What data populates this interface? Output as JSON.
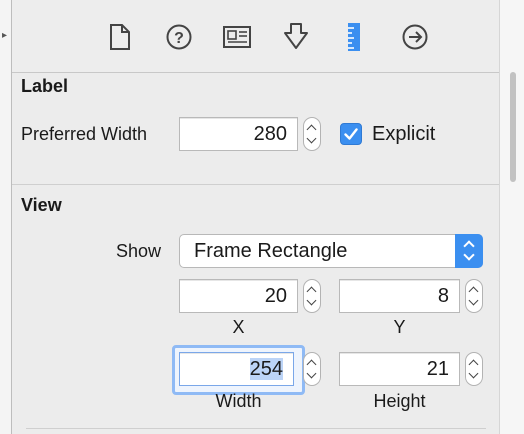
{
  "toolbar": {
    "icons": [
      "file-icon",
      "help-icon",
      "identity-icon",
      "attributes-icon",
      "ruler-icon",
      "connections-icon"
    ],
    "active": "ruler-icon",
    "active_color": "#3b8ff0"
  },
  "label_section": {
    "title": "Label",
    "preferred_width_label": "Preferred Width",
    "preferred_width_value": "280",
    "explicit_label": "Explicit",
    "explicit_checked": true
  },
  "view_section": {
    "title": "View",
    "show_label": "Show",
    "show_value": "Frame Rectangle",
    "x_value": "20",
    "x_label": "X",
    "y_value": "8",
    "y_label": "Y",
    "width_value": "254",
    "width_label": "Width",
    "height_value": "21",
    "height_label": "Height"
  }
}
